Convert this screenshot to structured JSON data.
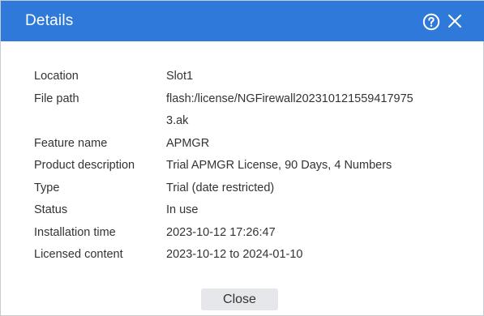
{
  "dialog": {
    "title": "Details",
    "help_icon": "help-circle-icon",
    "close_icon": "close-icon",
    "header_color": "#2f79db"
  },
  "details": {
    "location": {
      "label": "Location",
      "value": "Slot1"
    },
    "file_path": {
      "label": "File path",
      "value": "flash:/license/NGFirewall202310121559417975 3.ak"
    },
    "feature_name": {
      "label": "Feature name",
      "value": "APMGR"
    },
    "product_description": {
      "label": "Product description",
      "value": "Trial APMGR License, 90 Days, 4 Numbers"
    },
    "type": {
      "label": "Type",
      "value": "Trial (date restricted)"
    },
    "status": {
      "label": "Status",
      "value": "In use"
    },
    "installation_time": {
      "label": "Installation time",
      "value": "2023-10-12 17:26:47"
    },
    "licensed_content": {
      "label": "Licensed content",
      "value": "2023-10-12 to 2024-01-10"
    }
  },
  "footer": {
    "close_label": "Close"
  }
}
